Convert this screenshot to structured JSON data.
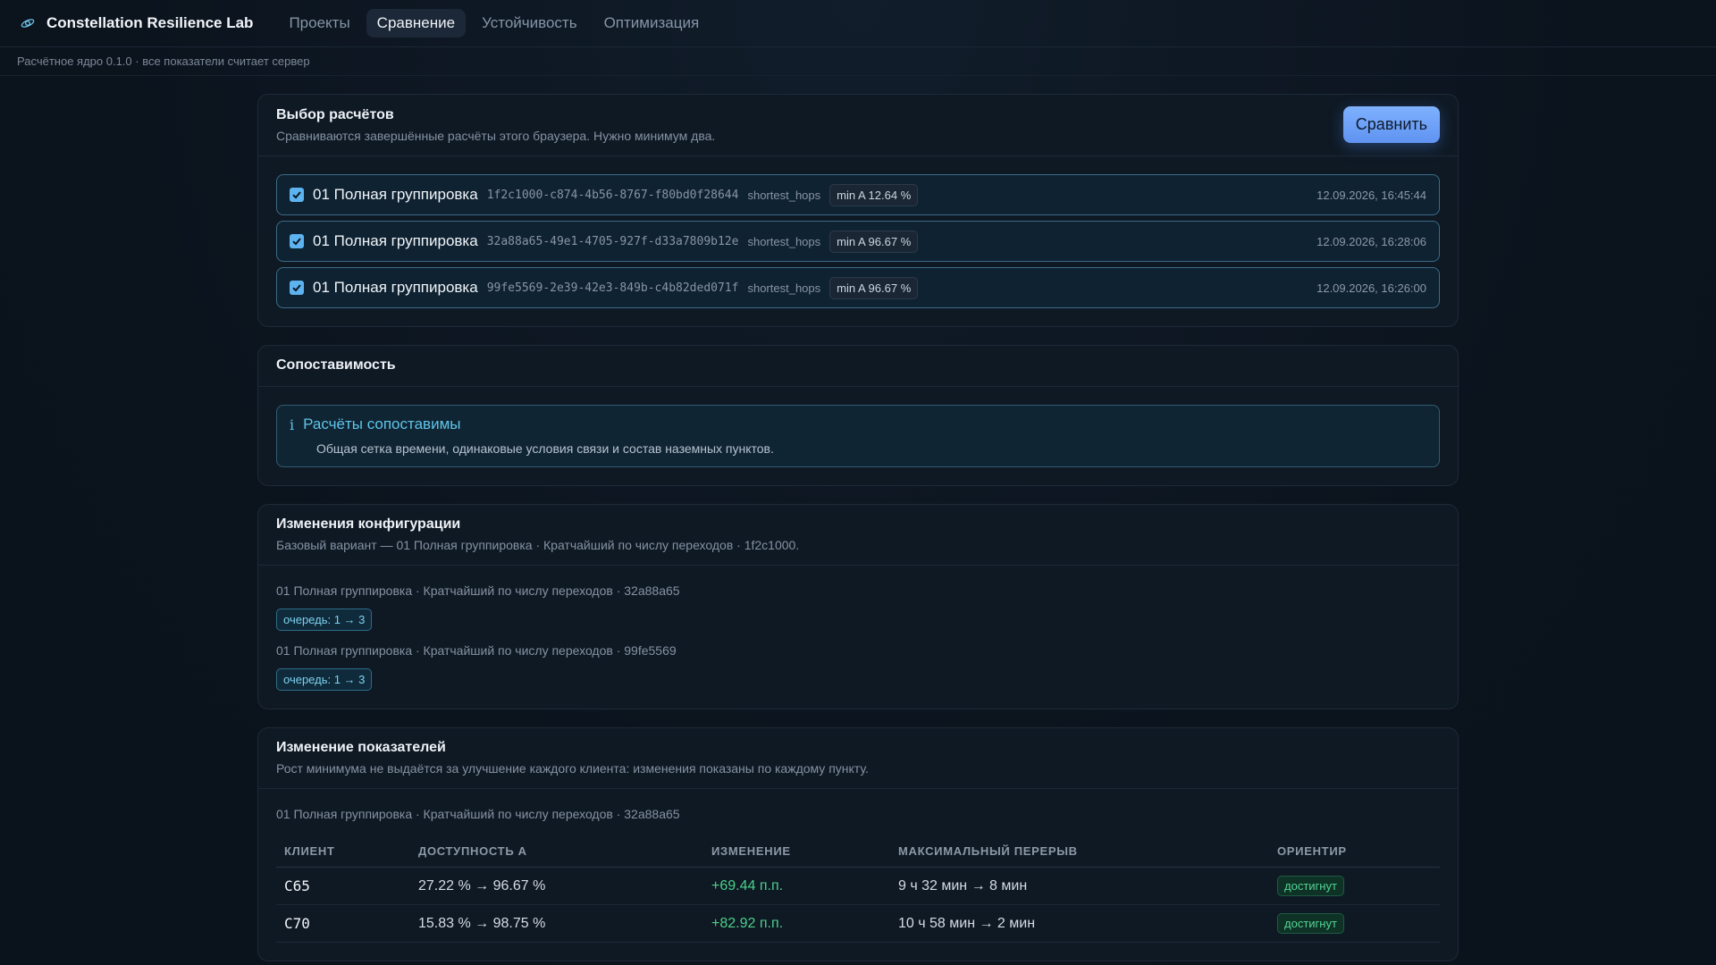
{
  "app": {
    "name": "Constellation Resilience Lab",
    "logo_icon": "satellite-icon",
    "nav": [
      {
        "label": "Проекты",
        "active": false
      },
      {
        "label": "Сравнение",
        "active": true
      },
      {
        "label": "Устойчивость",
        "active": false
      },
      {
        "label": "Оптимизация",
        "active": false
      }
    ],
    "subtitle": "Расчётное ядро 0.1.0 · все показатели считает сервер"
  },
  "selection": {
    "title": "Выбор расчётов",
    "description": "Сравниваются завершённые расчёты этого браузера. Нужно минимум два.",
    "compare_label": "Сравнить",
    "runs": [
      {
        "checked": true,
        "name": "01 Полная группировка",
        "id": "1f2c1000-c874-4b56-8767-f80bd0f28644",
        "algo": "shortest_hops",
        "badge": "min A 12.64 %",
        "date": "12.09.2026, 16:45:44"
      },
      {
        "checked": true,
        "name": "01 Полная группировка",
        "id": "32a88a65-49e1-4705-927f-d33a7809b12e",
        "algo": "shortest_hops",
        "badge": "min A 96.67 %",
        "date": "12.09.2026, 16:28:06"
      },
      {
        "checked": true,
        "name": "01 Полная группировка",
        "id": "99fe5569-2e39-42e3-849b-c4b82ded071f",
        "algo": "shortest_hops",
        "badge": "min A 96.67 %",
        "date": "12.09.2026, 16:26:00"
      }
    ]
  },
  "comparability": {
    "title": "Сопоставимость",
    "info_icon": "info-icon",
    "info_glyph": "i",
    "info_title": "Расчёты сопоставимы",
    "info_text": "Общая сетка времени, одинаковые условия связи и состав наземных пунктов."
  },
  "config": {
    "title": "Изменения конфигурации",
    "description": "Базовый вариант — 01 Полная группировка · Кратчайший по числу переходов · 1f2c1000.",
    "items": [
      {
        "line": "01 Полная группировка · Кратчайший по числу переходов · 32a88a65",
        "chip": "очередь: 1 → 3"
      },
      {
        "line": "01 Полная группировка · Кратчайший по числу переходов · 99fe5569",
        "chip": "очередь: 1 → 3"
      }
    ]
  },
  "metrics": {
    "title": "Изменение показателей",
    "description": "Рост минимума не выдаётся за улучшение каждого клиента: изменения показаны по каждому пункту.",
    "caption": "01 Полная группировка · Кратчайший по числу переходов · 32a88a65",
    "columns": [
      "КЛИЕНТ",
      "ДОСТУПНОСТЬ A",
      "ИЗМЕНЕНИЕ",
      "МАКСИМАЛЬНЫЙ ПЕРЕРЫВ",
      "ОРИЕНТИР"
    ],
    "rows": [
      {
        "client": "C65",
        "availability": "27.22 % → 96.67 %",
        "change": "+69.44 п.п.",
        "gap": "9 ч 32 мин → 8 мин",
        "target": "достигнут"
      },
      {
        "client": "C70",
        "availability": "15.83 % → 98.75 %",
        "change": "+82.92 п.п.",
        "gap": "10 ч 58 мин → 2 мин",
        "target": "достигнут"
      }
    ]
  }
}
